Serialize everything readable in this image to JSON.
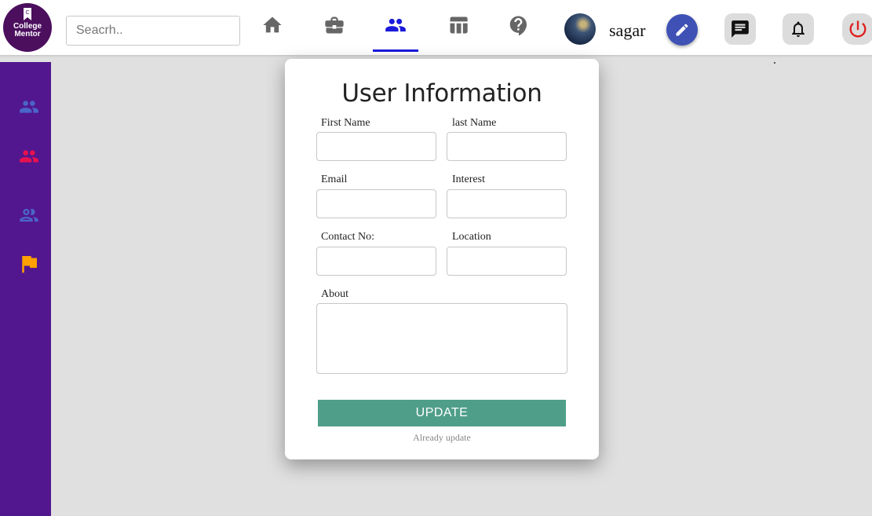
{
  "logo": {
    "line1": "College",
    "line2": "Mentor"
  },
  "search": {
    "placeholder": "Seacrh.."
  },
  "nav": {
    "items": [
      {
        "icon": "home-icon"
      },
      {
        "icon": "briefcase-icon"
      },
      {
        "icon": "people-icon",
        "active": true
      },
      {
        "icon": "table-icon"
      },
      {
        "icon": "help-icon"
      }
    ],
    "active_color": "#1a1adb",
    "inactive_color": "#666666"
  },
  "user": {
    "name": "sagar"
  },
  "actions": {
    "edit_color": "#3f51b5",
    "power_color": "#e02020"
  },
  "sidebar": {
    "background": "#52178f",
    "items": [
      {
        "icon": "group-icon",
        "color": "#4a66c9"
      },
      {
        "icon": "group-icon",
        "color": "#e8114f"
      },
      {
        "icon": "group-outline-icon",
        "color": "#4a66c9"
      },
      {
        "icon": "flag-icon",
        "color": "#ffa000"
      }
    ]
  },
  "form": {
    "title": "User Information",
    "fields": {
      "first_name": {
        "label": "First Name",
        "value": ""
      },
      "last_name": {
        "label": "last Name",
        "value": ""
      },
      "email": {
        "label": "Email",
        "value": ""
      },
      "interest": {
        "label": "Interest",
        "value": ""
      },
      "contact": {
        "label": "Contact No:",
        "value": ""
      },
      "location": {
        "label": "Location",
        "value": ""
      },
      "about": {
        "label": "About",
        "value": ""
      }
    },
    "submit_label": "UPDATE",
    "submit_color": "#4f9e89",
    "status_note": "Already update"
  }
}
